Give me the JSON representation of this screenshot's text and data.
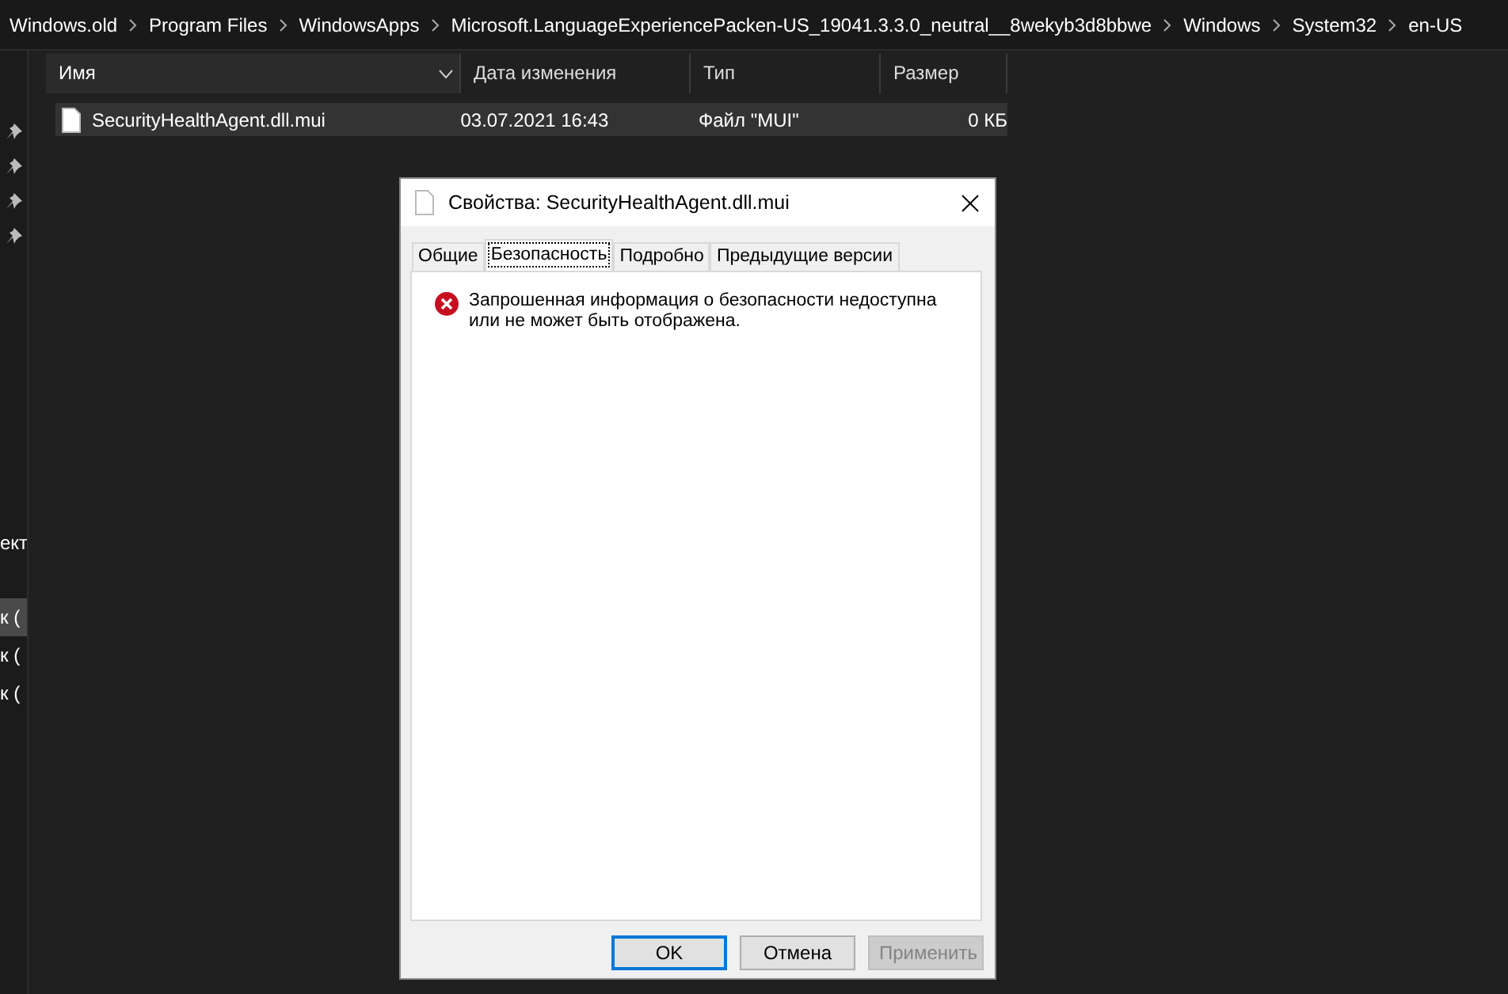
{
  "breadcrumb": [
    "Windows.old",
    "Program Files",
    "WindowsApps",
    "Microsoft.LanguageExperiencePacken-US_19041.3.3.0_neutral__8wekyb3d8bbwe",
    "Windows",
    "System32",
    "en-US"
  ],
  "sidebar": {
    "pinned_count_items": [
      {
        "pinned": true
      },
      {
        "pinned": true
      },
      {
        "pinned": true
      },
      {
        "pinned": true
      }
    ],
    "items": [
      {
        "label": "ект",
        "selected": false
      },
      {
        "label": "к (",
        "selected": true
      },
      {
        "label": "к (",
        "selected": false
      },
      {
        "label": "к (",
        "selected": false
      }
    ]
  },
  "table": {
    "columns": [
      "Имя",
      "Дата изменения",
      "Тип",
      "Размер"
    ],
    "rows": [
      {
        "name": "SecurityHealthAgent.dll.mui",
        "date": "03.07.2021 16:43",
        "type": "Файл \"MUI\"",
        "size": "0 КБ",
        "selected": true
      }
    ]
  },
  "dialog": {
    "title": "Свойства: SecurityHealthAgent.dll.mui",
    "tabs": [
      {
        "label": "Общие",
        "selected": false
      },
      {
        "label": "Безопасность",
        "selected": true
      },
      {
        "label": "Подробно",
        "selected": false
      },
      {
        "label": "Предыдущие версии",
        "selected": false
      }
    ],
    "error_message": "Запрошенная информация о безопасности недоступна или не может быть отображена.",
    "buttons": [
      {
        "label": "OK",
        "default": true,
        "disabled": false
      },
      {
        "label": "Отмена",
        "default": false,
        "disabled": false
      },
      {
        "label": "Применить",
        "default": false,
        "disabled": true
      }
    ]
  }
}
